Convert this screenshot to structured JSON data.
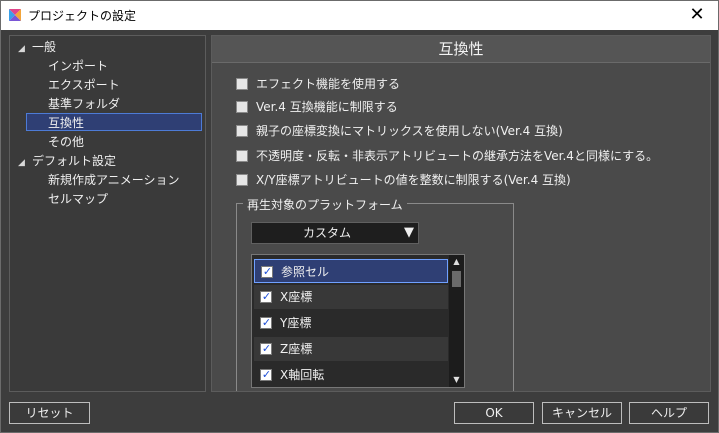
{
  "window": {
    "title": "プロジェクトの設定",
    "close_glyph": "✕"
  },
  "tree": {
    "items": [
      {
        "label": "一般",
        "expanded": true,
        "level": 0
      },
      {
        "label": "インポート",
        "level": 1
      },
      {
        "label": "エクスポート",
        "level": 1
      },
      {
        "label": "基準フォルダ",
        "level": 1
      },
      {
        "label": "互換性",
        "level": 1,
        "selected": true
      },
      {
        "label": "その他",
        "level": 1
      },
      {
        "label": "デフォルト設定",
        "expanded": true,
        "level": 0
      },
      {
        "label": "新規作成アニメーション",
        "level": 1
      },
      {
        "label": "セルマップ",
        "level": 1
      }
    ],
    "expand_glyph": "◢"
  },
  "panel": {
    "title": "互換性",
    "options": [
      {
        "label": "エフェクト機能を使用する",
        "checked": false
      },
      {
        "label": "Ver.4 互換機能に制限する",
        "checked": false
      },
      {
        "label": "親子の座標変換にマトリックスを使用しない(Ver.4 互換)",
        "checked": false
      },
      {
        "label": "不透明度・反転・非表示アトリビュートの継承方法をVer.4と同様にする。",
        "checked": false
      },
      {
        "label": "X/Y座標アトリビュートの値を整数に制限する(Ver.4 互換)",
        "checked": false
      }
    ],
    "platform_group": {
      "title": "再生対象のプラットフォーム",
      "dropdown_value": "カスタム",
      "dropdown_arrow": "▼",
      "list": [
        {
          "label": "参照セル",
          "checked": true,
          "selected": true
        },
        {
          "label": "X座標",
          "checked": true
        },
        {
          "label": "Y座標",
          "checked": true
        },
        {
          "label": "Z座標",
          "checked": true
        },
        {
          "label": "X軸回転",
          "checked": true
        }
      ],
      "check_glyph": "✓",
      "scroll_up_glyph": "▲",
      "scroll_down_glyph": "▼"
    }
  },
  "buttons": {
    "reset": "リセット",
    "ok": "OK",
    "cancel": "キャンセル",
    "help": "ヘルプ"
  },
  "colors": {
    "selection": "#2f3f74",
    "selection_border": "#4d7bd6",
    "check": "#1e4fd8"
  }
}
